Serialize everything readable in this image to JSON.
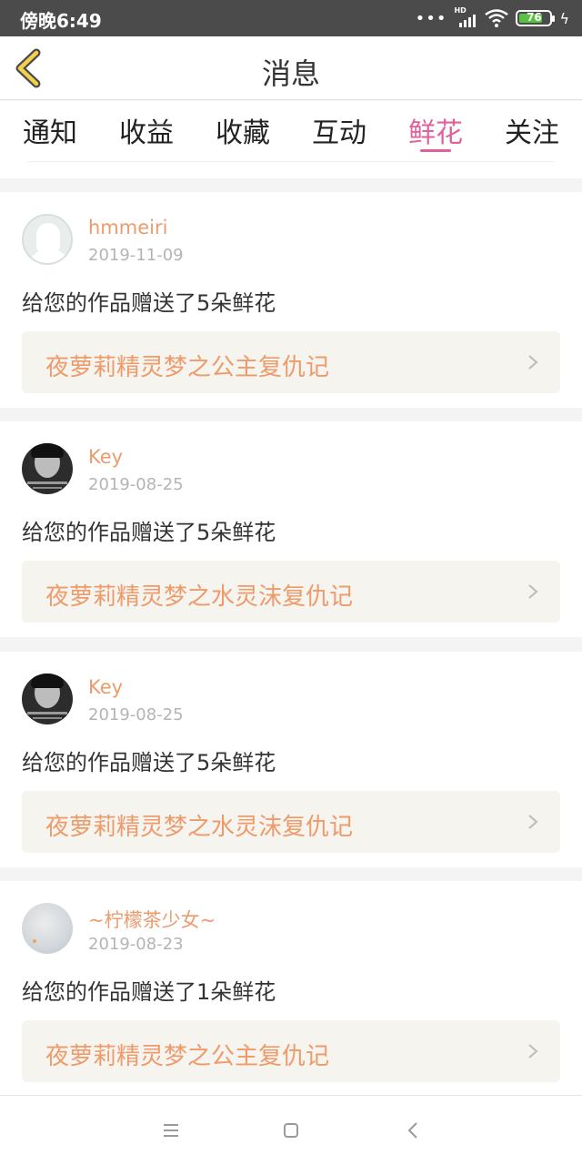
{
  "status_bar": {
    "time": "傍晚6:49",
    "signal_label": "HD",
    "battery": "76",
    "icons": [
      "dots-icon",
      "signal-icon",
      "wifi-icon",
      "battery-icon",
      "charging-icon"
    ]
  },
  "header": {
    "title": "消息",
    "back_icon": "chevron-left-icon",
    "accent_color": "#f2d24b"
  },
  "tabs": [
    {
      "label": "通知",
      "active": false
    },
    {
      "label": "收益",
      "active": false
    },
    {
      "label": "收藏",
      "active": false
    },
    {
      "label": "互动",
      "active": false
    },
    {
      "label": "鲜花",
      "active": true
    },
    {
      "label": "关注",
      "active": false
    }
  ],
  "colors": {
    "active_tab": "#e0609a",
    "username": "#ee9b6c",
    "work_title": "#ee9b6c",
    "link_bg": "#f5f4ee"
  },
  "messages": [
    {
      "user": "hmmeiri",
      "date": "2019-11-09",
      "text": "给您的作品赠送了5朵鲜花",
      "work": "夜萝莉精灵梦之公主复仇记"
    },
    {
      "user": "Key",
      "date": "2019-08-25",
      "text": "给您的作品赠送了5朵鲜花",
      "work": "夜萝莉精灵梦之水灵沫复仇记"
    },
    {
      "user": "Key",
      "date": "2019-08-25",
      "text": "给您的作品赠送了5朵鲜花",
      "work": "夜萝莉精灵梦之水灵沫复仇记"
    },
    {
      "user": "~柠檬茶少女~",
      "date": "2019-08-23",
      "text": "给您的作品赠送了1朵鲜花",
      "work": "夜萝莉精灵梦之公主复仇记"
    }
  ],
  "nav_bar": {
    "icons": [
      "menu-icon",
      "home-icon",
      "back-icon"
    ]
  }
}
